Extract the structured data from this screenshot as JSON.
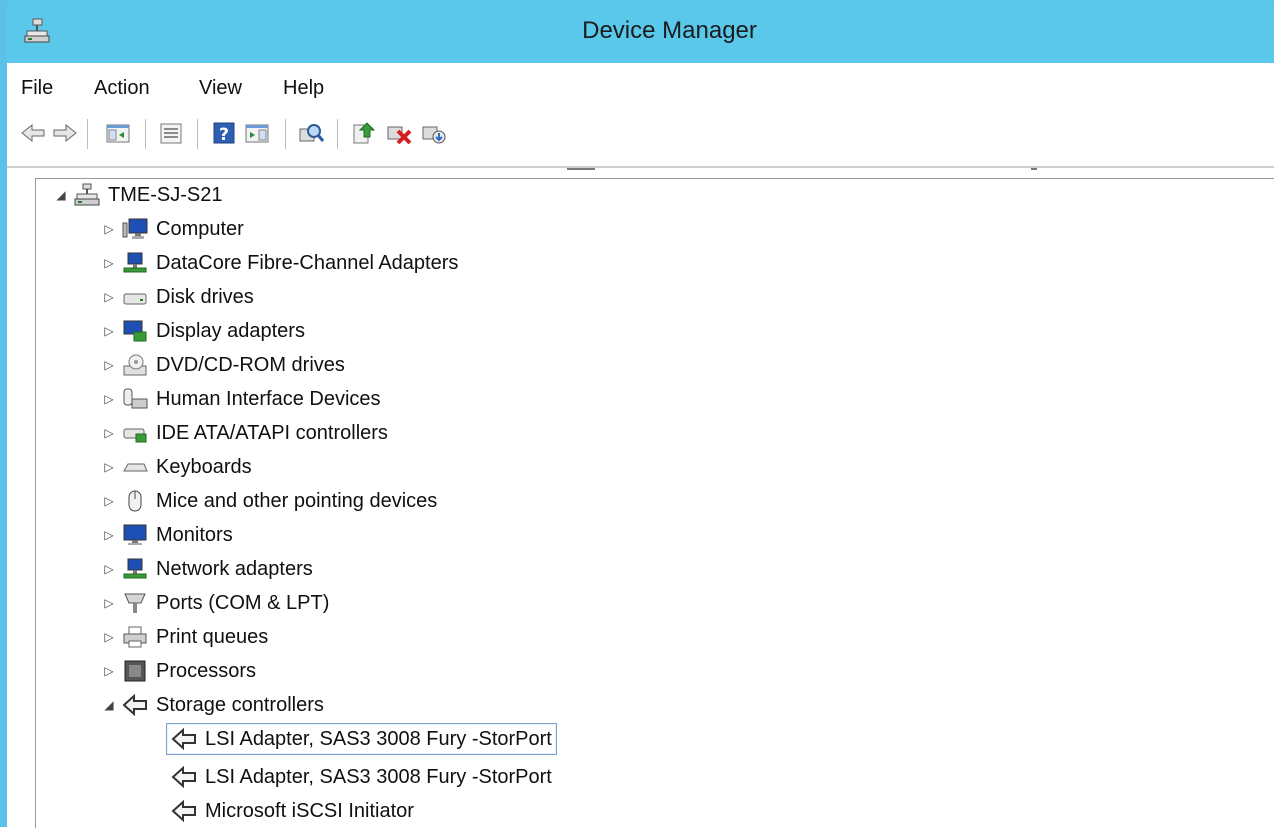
{
  "window": {
    "title": "Device Manager",
    "app_icon": "device-manager-icon"
  },
  "menu": {
    "items": [
      "File",
      "Action",
      "View",
      "Help"
    ]
  },
  "toolbar": {
    "buttons": [
      "back-icon",
      "forward-icon",
      "show-hide-console-tree-icon",
      "properties-icon",
      "help-icon",
      "show-hide-action-pane-icon",
      "scan-hardware-icon",
      "update-driver-icon",
      "uninstall-device-icon",
      "enable-device-icon"
    ]
  },
  "tree": {
    "root": {
      "label": "TME-SJ-S21",
      "expanded": true,
      "icon": "computer-root-icon"
    },
    "categories": [
      {
        "label": "Computer",
        "icon": "computer-icon",
        "expanded": false
      },
      {
        "label": "DataCore Fibre-Channel Adapters",
        "icon": "network-adapter-icon",
        "expanded": false
      },
      {
        "label": "Disk drives",
        "icon": "disk-drive-icon",
        "expanded": false
      },
      {
        "label": "Display adapters",
        "icon": "display-adapter-icon",
        "expanded": false
      },
      {
        "label": "DVD/CD-ROM drives",
        "icon": "dvd-drive-icon",
        "expanded": false
      },
      {
        "label": "Human Interface Devices",
        "icon": "hid-icon",
        "expanded": false
      },
      {
        "label": "IDE ATA/ATAPI controllers",
        "icon": "ide-controller-icon",
        "expanded": false
      },
      {
        "label": "Keyboards",
        "icon": "keyboard-icon",
        "expanded": false
      },
      {
        "label": "Mice and other pointing devices",
        "icon": "mouse-icon",
        "expanded": false
      },
      {
        "label": "Monitors",
        "icon": "monitor-icon",
        "expanded": false
      },
      {
        "label": "Network adapters",
        "icon": "network-adapter-icon",
        "expanded": false
      },
      {
        "label": "Ports (COM & LPT)",
        "icon": "port-icon",
        "expanded": false
      },
      {
        "label": "Print queues",
        "icon": "printer-icon",
        "expanded": false
      },
      {
        "label": "Processors",
        "icon": "processor-icon",
        "expanded": false
      },
      {
        "label": "Storage controllers",
        "icon": "storage-controller-icon",
        "expanded": true
      }
    ],
    "storage_children": [
      {
        "label": "LSI Adapter, SAS3 3008 Fury -StorPort",
        "selected": true
      },
      {
        "label": "LSI Adapter, SAS3 3008 Fury -StorPort",
        "selected": false
      },
      {
        "label": "Microsoft iSCSI Initiator",
        "selected": false
      }
    ]
  },
  "colors": {
    "titlebar": "#5ac8ea",
    "selection_border": "#7da2ce"
  }
}
